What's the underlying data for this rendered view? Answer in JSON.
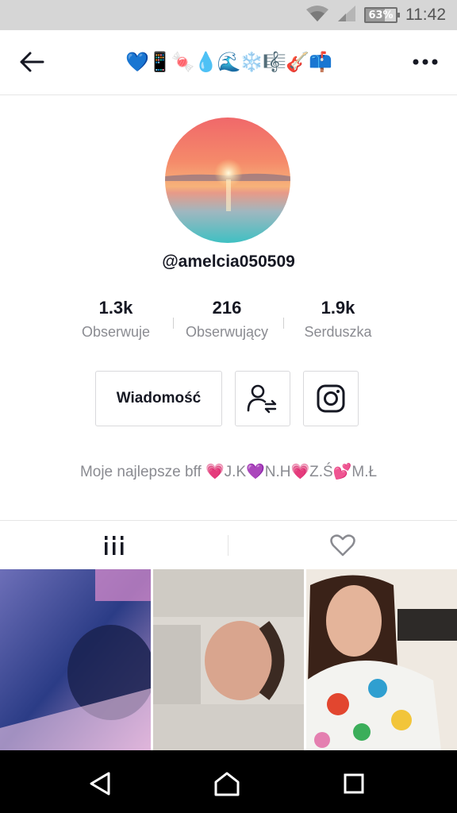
{
  "status_bar": {
    "battery_percent": "63%",
    "battery_level": 0.63,
    "time": "11:42",
    "icons": [
      "wifi-icon",
      "cellular-signal-icon",
      "battery-icon"
    ]
  },
  "header": {
    "title": "💙📱🍬💧🌊❄️🎼🎸📫",
    "back_icon": "arrow-left-icon",
    "more_icon": "more-horizontal-icon"
  },
  "profile": {
    "username": "@amelcia050509",
    "stats": [
      {
        "value": "1.3k",
        "label": "Obserwuje"
      },
      {
        "value": "216",
        "label": "Obserwujący"
      },
      {
        "value": "1.9k",
        "label": "Serduszka"
      }
    ],
    "message_button_label": "Wiadomość",
    "friends_icon": "user-swap-icon",
    "instagram_icon": "instagram-icon",
    "bio": "Moje najlepsze bff 💗J.K💜N.H💗Z.Ś💕M.Ł"
  },
  "tabs": [
    {
      "icon": "grid-videos-icon",
      "active": true
    },
    {
      "icon": "heart-outline-icon",
      "active": false
    }
  ],
  "colors": {
    "text_primary": "#161823",
    "text_secondary": "#8a8b91",
    "border": "#d9d9dc",
    "status_bar_bg": "#d6d6d6",
    "nav_bar_bg": "#000000"
  },
  "system_nav": {
    "icons": [
      "triangle-back-icon",
      "circle-home-icon",
      "square-recents-icon"
    ]
  }
}
